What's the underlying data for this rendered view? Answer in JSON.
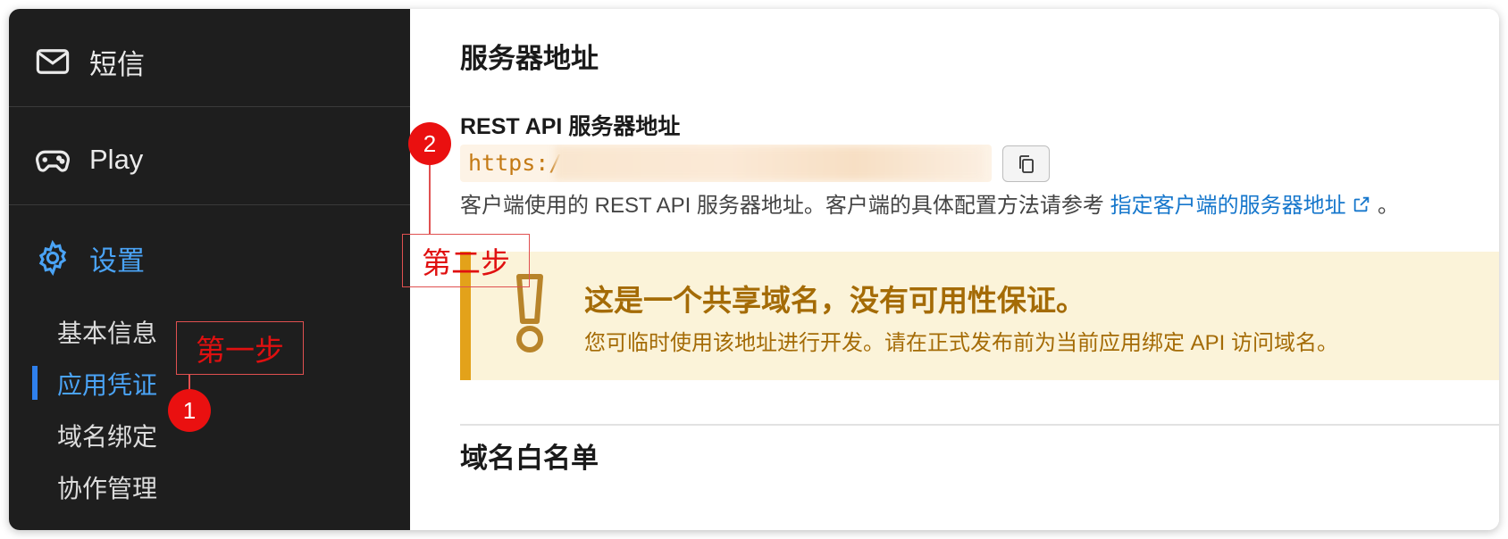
{
  "sidebar": {
    "items": [
      {
        "label": "短信",
        "icon": "mail-icon"
      },
      {
        "label": "Play",
        "icon": "gamepad-icon"
      },
      {
        "label": "设置",
        "icon": "gear-icon"
      }
    ],
    "sub_items": [
      "基本信息",
      "应用凭证",
      "域名绑定",
      "协作管理"
    ],
    "active_sub": "应用凭证"
  },
  "main": {
    "section1_title": "服务器地址",
    "rest_label": "REST API 服务器地址",
    "url_prefix": "https:/",
    "copy_icon": "copy-icon",
    "desc_text": "客户端使用的 REST API 服务器地址。客户端的具体配置方法请参考",
    "desc_link": "指定客户端的服务器地址",
    "desc_end": "。",
    "warning_title": "这是一个共享域名，没有可用性保证。",
    "warning_body": "您可临时使用该地址进行开发。请在正式发布前为当前应用绑定 API 访问域名。",
    "section2_title": "域名白名单"
  },
  "annotations": {
    "step1": "第一步",
    "step2": "第二步",
    "num1": "1",
    "num2": "2"
  },
  "colors": {
    "sidebar_bg": "#1e1e1e",
    "accent": "#4aa3f5",
    "warning": "#a46b06",
    "annotation": "#ea1010"
  }
}
